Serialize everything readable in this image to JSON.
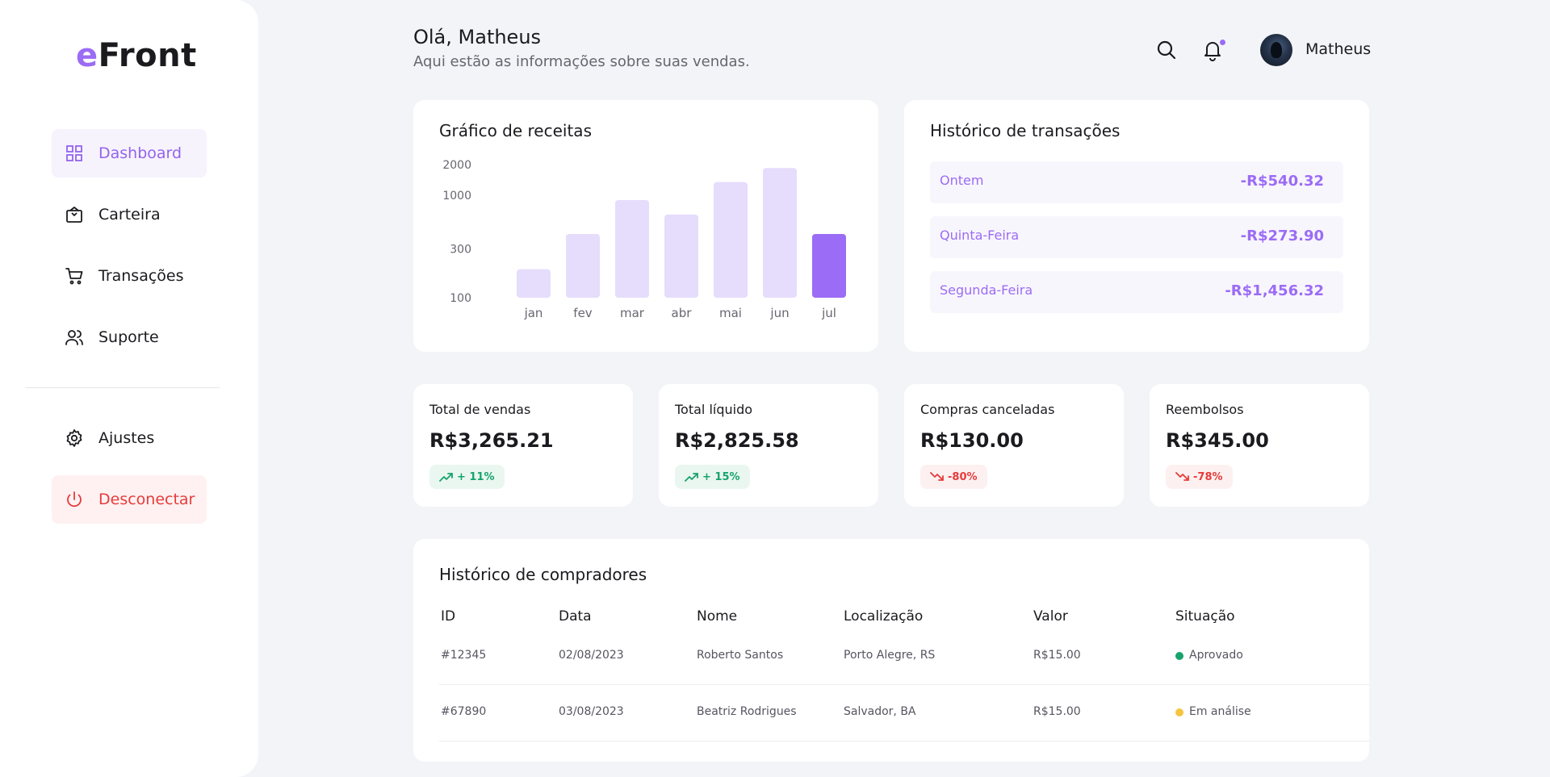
{
  "brand": {
    "logo_accent": "e",
    "logo_rest": "Front"
  },
  "sidebar": {
    "items": [
      {
        "label": "Dashboard",
        "icon": "grid-icon"
      },
      {
        "label": "Carteira",
        "icon": "wallet-icon"
      },
      {
        "label": "Transações",
        "icon": "cart-icon"
      },
      {
        "label": "Suporte",
        "icon": "users-icon"
      }
    ],
    "settings": {
      "label": "Ajustes",
      "icon": "gear-icon"
    },
    "logout": {
      "label": "Desconectar",
      "icon": "power-icon"
    }
  },
  "header": {
    "greeting": "Olá, Matheus",
    "subtitle": "Aqui estão as informações sobre suas vendas.",
    "username": "Matheus",
    "icons": [
      "search-icon",
      "bell-icon"
    ]
  },
  "revenue": {
    "title": "Gráfico de receitas"
  },
  "chart_data": {
    "type": "bar",
    "categories": [
      "jan",
      "fev",
      "mar",
      "abr",
      "mai",
      "jun",
      "jul"
    ],
    "values": [
      190,
      420,
      900,
      650,
      1350,
      1850,
      420
    ],
    "highlight_index": 6,
    "y_ticks": [
      "2000",
      "1000",
      "300",
      "100"
    ],
    "ylim": [
      100,
      2000
    ],
    "scale": "log",
    "grid": false,
    "colors": {
      "bar": "#e6dcfb",
      "highlight": "#9b6cf5"
    }
  },
  "transactions": {
    "title": "Histórico de transações",
    "items": [
      {
        "day": "Ontem",
        "amount": "-R$540.32"
      },
      {
        "day": "Quinta-Feira",
        "amount": "-R$273.90"
      },
      {
        "day": "Segunda-Feira",
        "amount": "-R$1,456.32"
      }
    ]
  },
  "stats": [
    {
      "label": "Total de vendas",
      "value": "R$3,265.21",
      "change": "+ 11%",
      "trend": "up"
    },
    {
      "label": "Total líquido",
      "value": "R$2,825.58",
      "change": "+ 15%",
      "trend": "up"
    },
    {
      "label": "Compras canceladas",
      "value": "R$130.00",
      "change": "-80%",
      "trend": "down"
    },
    {
      "label": "Reembolsos",
      "value": "R$345.00",
      "change": "-78%",
      "trend": "down"
    }
  ],
  "buyers": {
    "title": "Histórico de compradores",
    "columns": [
      "ID",
      "Data",
      "Nome",
      "Localização",
      "Valor",
      "Situação"
    ],
    "rows": [
      {
        "id": "#12345",
        "date": "02/08/2023",
        "name": "Roberto Santos",
        "location": "Porto Alegre, RS",
        "value": "R$15.00",
        "status": "Aprovado",
        "status_color": "#17a36b"
      },
      {
        "id": "#67890",
        "date": "03/08/2023",
        "name": "Beatriz Rodrigues",
        "location": "Salvador, BA",
        "value": "R$15.00",
        "status": "Em análise",
        "status_color": "#f5c542"
      }
    ]
  },
  "colors": {
    "accent": "#9b6cf5",
    "danger": "#e63b3b",
    "success": "#17a36b",
    "warning": "#f5c542"
  }
}
